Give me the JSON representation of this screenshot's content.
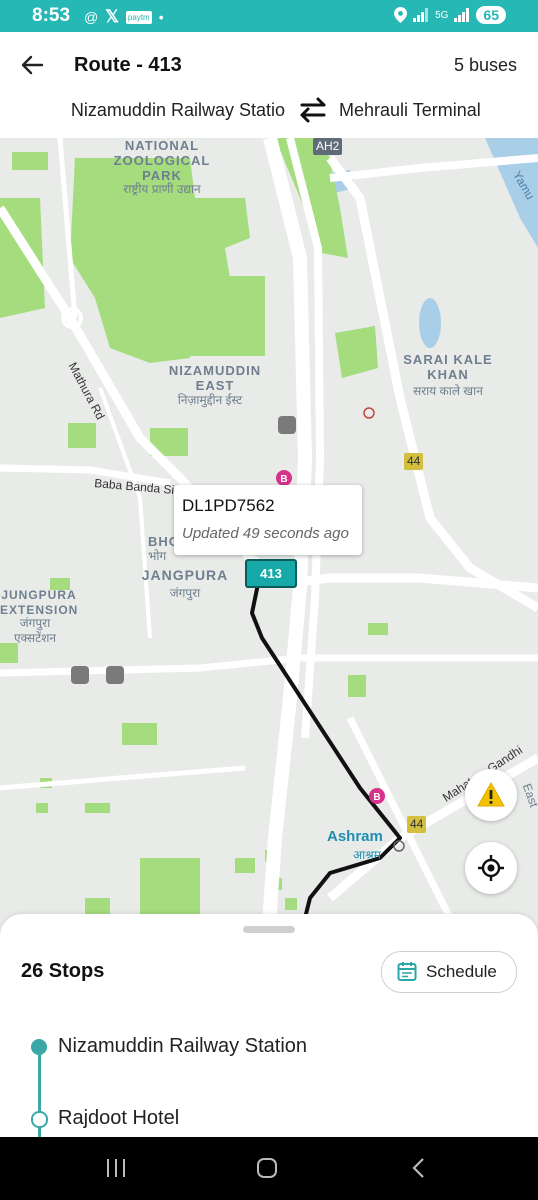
{
  "status_bar": {
    "time": "8:53",
    "network": "5G",
    "battery": "65"
  },
  "header": {
    "title": "Route - 413",
    "bus_count": "5 buses",
    "from": "Nizamuddin Railway Statio",
    "to": "Mehrauli Terminal"
  },
  "map": {
    "labels": {
      "zoo_en": "NATIONAL ZOOLOGICAL PARK",
      "zoo_hi": "राष्ट्रीय प्राणी उद्यान",
      "nizamuddin_en": "NIZAMUDDIN EAST",
      "nizamuddin_hi": "निज़ामुद्दीन ईस्ट",
      "sarai_en": "SARAI KALE KHAN",
      "sarai_hi": "सराय काले खान",
      "jangpura_en": "JANGPURA",
      "jangpura_hi": "जंगपुरा",
      "jext_en": "JUNGPURA EXTENSION",
      "jext_hi": "जंगपुरा एक्सटेंशन",
      "bhog_en": "BHO",
      "bhog_hi": "भोग",
      "ashram_en": "Ashram",
      "ashram_hi": "आश्रम",
      "mathura_rd": "Mathura Rd",
      "baba_banda": "Baba Banda Singh Baha",
      "mg_road": "Mahatma Gandhi",
      "yamuna": "Yamu",
      "east": "East",
      "ah2": "AH2",
      "nh44_a": "44",
      "nh44_b": "44"
    },
    "callout": {
      "plate": "DL1PD7562",
      "updated": "Updated 49 seconds ago"
    },
    "bus_marker": "413",
    "colors": {
      "route": "#111111",
      "bus": "#17a8a8",
      "parks": "#a4dc7e",
      "water": "#a9cfe8",
      "bus_stop_badge": "#d6338a"
    }
  },
  "sheet": {
    "stops_title": "26 Stops",
    "schedule_label": "Schedule",
    "stops": [
      "Nizamuddin Railway Station",
      "Rajdoot Hotel"
    ]
  },
  "accent_color": "#26b8b5"
}
